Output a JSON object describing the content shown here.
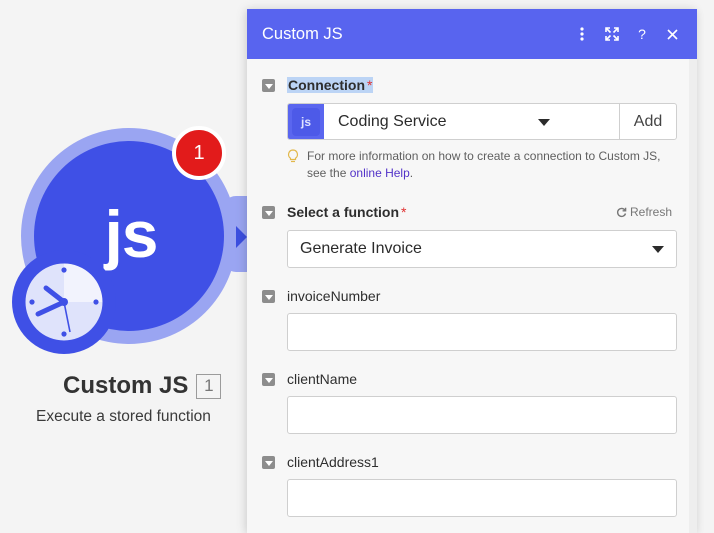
{
  "module": {
    "icon_text": "js",
    "badge_count": "1",
    "title": "Custom JS",
    "id": "1",
    "subtitle": "Execute a stored function"
  },
  "panel": {
    "title": "Custom JS",
    "header_icons": [
      "more-vertical-icon",
      "expand-icon",
      "help-icon",
      "close-icon"
    ],
    "accent_color": "#5864ef"
  },
  "connection": {
    "label": "Connection",
    "required_mark": "*",
    "app_icon_text": "js",
    "selected": "Coding Service",
    "add_label": "Add",
    "help_text": "For more information on how to create a connection to Custom JS, see the",
    "help_link": "online Help",
    "help_end": "."
  },
  "function_field": {
    "label": "Select a function",
    "required_mark": "*",
    "refresh_label": "Refresh",
    "selected": "Generate Invoice"
  },
  "fields": [
    {
      "label": "invoiceNumber",
      "value": ""
    },
    {
      "label": "clientName",
      "value": ""
    },
    {
      "label": "clientAddress1",
      "value": ""
    }
  ]
}
